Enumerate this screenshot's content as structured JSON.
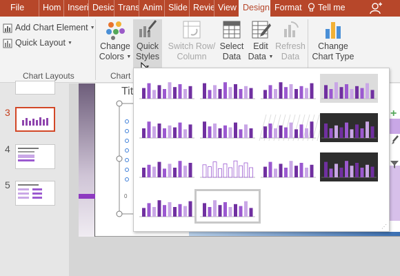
{
  "tabs": [
    {
      "label": "File"
    },
    {
      "label": "Hom"
    },
    {
      "label": "Inseri"
    },
    {
      "label": "Desic"
    },
    {
      "label": "Trans"
    },
    {
      "label": "Anim"
    },
    {
      "label": "Slide"
    },
    {
      "label": "Revie"
    },
    {
      "label": "View"
    },
    {
      "label": "Design",
      "active": true
    },
    {
      "label": "Format"
    }
  ],
  "tell_me": "Tell me",
  "ribbon": {
    "add_chart_element": "Add Chart Element",
    "quick_layout": "Quick Layout",
    "chart_layouts_label": "Chart Layouts",
    "change_colors": [
      "Change",
      "Colors"
    ],
    "quick_styles": [
      "Quick",
      "Styles"
    ],
    "chart_styles_label": "Chart",
    "switch_row_column": [
      "Switch Row/",
      "Column"
    ],
    "select_data": [
      "Select",
      "Data"
    ],
    "edit_data": [
      "Edit",
      "Data"
    ],
    "refresh_data": [
      "Refresh",
      "Data"
    ],
    "change_chart_type": [
      "Change",
      "Chart Type"
    ]
  },
  "slides": [
    {
      "number": "3",
      "active": true
    },
    {
      "number": "4"
    },
    {
      "number": "5"
    }
  ],
  "slide": {
    "title_fragment": "Titl"
  },
  "colors": {
    "accent": "#b7472a",
    "purple_dark": "#7030a0",
    "purple_mid": "#9b59d0",
    "purple_light": "#c9a7e6"
  },
  "gallery": {
    "styles": [
      {
        "bg": "none",
        "selected": false
      },
      {
        "bg": "none",
        "selected": false
      },
      {
        "bg": "none",
        "selected": false
      },
      {
        "bg": "grey",
        "selected": false
      },
      {
        "bg": "none",
        "selected": false
      },
      {
        "bg": "none",
        "selected": false
      },
      {
        "bg": "hatch",
        "selected": false
      },
      {
        "bg": "dark",
        "selected": false
      },
      {
        "bg": "none",
        "selected": false
      },
      {
        "bg": "none",
        "selected": false
      },
      {
        "bg": "none",
        "selected": false
      },
      {
        "bg": "dark",
        "selected": false
      },
      {
        "bg": "none",
        "selected": false
      },
      {
        "bg": "none",
        "selected": true
      }
    ]
  }
}
